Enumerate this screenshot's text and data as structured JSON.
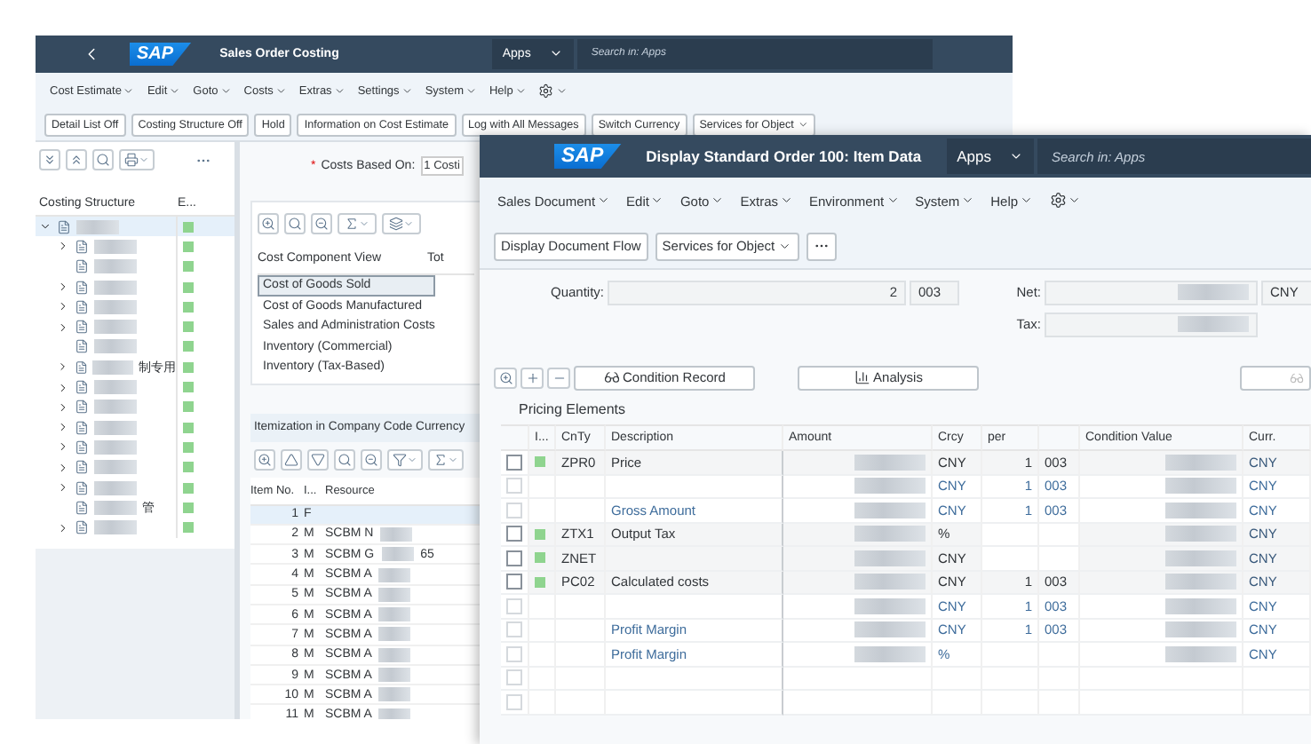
{
  "back_window": {
    "logo_text": "SAP",
    "title": "Sales Order Costing",
    "apps_label": "Apps",
    "search": {
      "placeholder": "Search in: Apps"
    },
    "menu": [
      "Cost Estimate",
      "Edit",
      "Goto",
      "Costs",
      "Extras",
      "Settings",
      "System",
      "Help"
    ],
    "toolbar": [
      {
        "label": "Detail List Off",
        "kind": "plain"
      },
      {
        "label": "Costing Structure Off",
        "kind": "plain"
      },
      {
        "label": "Hold",
        "kind": "plain"
      },
      {
        "label": "Information on Cost Estimate",
        "kind": "plain"
      },
      {
        "label": "Log with All Messages",
        "kind": "plain"
      },
      {
        "label": "Switch Currency",
        "kind": "plain"
      },
      {
        "label": "Services for Object",
        "kind": "dropdown"
      }
    ],
    "costing_structure": {
      "columns": [
        "Costing Structure",
        "E..."
      ],
      "tree": [
        {
          "selected": true,
          "expanded": true,
          "children": [
            {
              "expanded": false,
              "selected": false
            },
            {
              "selected": false
            },
            {
              "expanded": false,
              "selected": false
            },
            {
              "expanded": false,
              "selected": false
            },
            {
              "expanded": false,
              "selected": false
            },
            {
              "selected": false
            },
            {
              "label": "制专用",
              "expanded": false,
              "selected": false
            },
            {
              "expanded": false,
              "selected": false
            },
            {
              "expanded": false,
              "selected": false
            },
            {
              "expanded": false,
              "selected": false
            },
            {
              "expanded": false,
              "selected": false
            },
            {
              "expanded": false,
              "selected": false
            },
            {
              "expanded": false,
              "selected": false
            },
            {
              "label": "管",
              "selected": false
            },
            {
              "expanded": false,
              "selected": false
            }
          ]
        }
      ]
    },
    "costs_based_on": {
      "required_mark": "*",
      "label": "Costs Based On:",
      "value": "1 Costi"
    },
    "cost_components": {
      "columns": [
        "Cost Component View",
        "Tot"
      ],
      "rows": [
        {
          "label": "Cost of Goods Sold",
          "selected": true
        },
        {
          "label": "Cost of Goods Manufactured",
          "selected": false
        },
        {
          "label": "Sales and Administration Costs",
          "selected": false
        },
        {
          "label": "Inventory (Commercial)",
          "selected": false
        },
        {
          "label": "Inventory (Tax-Based)",
          "selected": false
        }
      ]
    },
    "itemization": {
      "title": "Itemization in Company Code Currency",
      "columns": [
        "Item No.",
        "I...",
        "Resource"
      ],
      "rows": [
        {
          "item_no": "1",
          "i": "F",
          "selected": true
        },
        {
          "item_no": "2",
          "i": "M",
          "resource": "SCBM N",
          "selected": false
        },
        {
          "item_no": "3",
          "i": "M",
          "resource": "SCBM G",
          "resource_tail": "65",
          "selected": false
        },
        {
          "item_no": "4",
          "i": "M",
          "resource": "SCBM A",
          "selected": false
        },
        {
          "item_no": "5",
          "i": "M",
          "resource": "SCBM A",
          "selected": false
        },
        {
          "item_no": "6",
          "i": "M",
          "resource": "SCBM A",
          "selected": false
        },
        {
          "item_no": "7",
          "i": "M",
          "resource": "SCBM A",
          "selected": false
        },
        {
          "item_no": "8",
          "i": "M",
          "resource": "SCBM A",
          "selected": false
        },
        {
          "item_no": "9",
          "i": "M",
          "resource": "SCBM A",
          "selected": false
        },
        {
          "item_no": "10",
          "i": "M",
          "resource": "SCBM A",
          "selected": false
        },
        {
          "item_no": "11",
          "i": "M",
          "resource": "SCBM A",
          "selected": false
        }
      ]
    }
  },
  "front_window": {
    "logo_text": "SAP",
    "title": "Display Standard Order 100: Item Data",
    "apps_label": "Apps",
    "search": {
      "placeholder": "Search in: Apps"
    },
    "menu": [
      "Sales Document",
      "Edit",
      "Goto",
      "Extras",
      "Environment",
      "System",
      "Help"
    ],
    "toolbar": [
      {
        "label": "Display Document Flow",
        "kind": "plain"
      },
      {
        "label": "Services for Object",
        "kind": "dropdown"
      }
    ],
    "quantity": {
      "label": "Quantity:",
      "value": "2",
      "unit": "003"
    },
    "net": {
      "label": "Net:",
      "currency": "CNY"
    },
    "tax": {
      "label": "Tax:"
    },
    "table_buttons": [
      {
        "label": "Condition Record",
        "kind": "record"
      },
      {
        "label": "Analysis",
        "kind": "analysis"
      }
    ],
    "section_title": "Pricing Elements",
    "columns": [
      "I...",
      "CnTy",
      "Description",
      "Amount",
      "Crcy",
      "per",
      "Condition Value",
      "Curr."
    ],
    "rows": [
      {
        "kind": "condition",
        "type": "ZPR0",
        "description": "Price",
        "crcy": "CNY",
        "per": "1",
        "unit": "003",
        "curr": "CNY"
      },
      {
        "kind": "subtotal",
        "crcy": "CNY",
        "per": "1",
        "unit": "003",
        "curr": "CNY"
      },
      {
        "kind": "subtotal",
        "description": "Gross Amount",
        "crcy": "CNY",
        "per": "1",
        "unit": "003",
        "curr": "CNY"
      },
      {
        "kind": "condition",
        "type": "ZTX1",
        "description": "Output Tax",
        "crcy": "%",
        "curr": "CNY"
      },
      {
        "kind": "condition",
        "type": "ZNET",
        "crcy": "CNY",
        "curr": "CNY"
      },
      {
        "kind": "condition",
        "type": "PC02",
        "description": "Calculated costs",
        "crcy": "CNY",
        "per": "1",
        "unit": "003",
        "curr": "CNY"
      },
      {
        "kind": "subtotal",
        "crcy": "CNY",
        "per": "1",
        "unit": "003",
        "curr": "CNY"
      },
      {
        "kind": "subtotal",
        "description": "Profit Margin",
        "crcy": "CNY",
        "per": "1",
        "unit": "003",
        "curr": "CNY"
      },
      {
        "kind": "subtotal",
        "description": "Profit Margin",
        "crcy": "%",
        "curr": "CNY"
      },
      {
        "kind": "empty"
      },
      {
        "kind": "empty"
      }
    ]
  }
}
